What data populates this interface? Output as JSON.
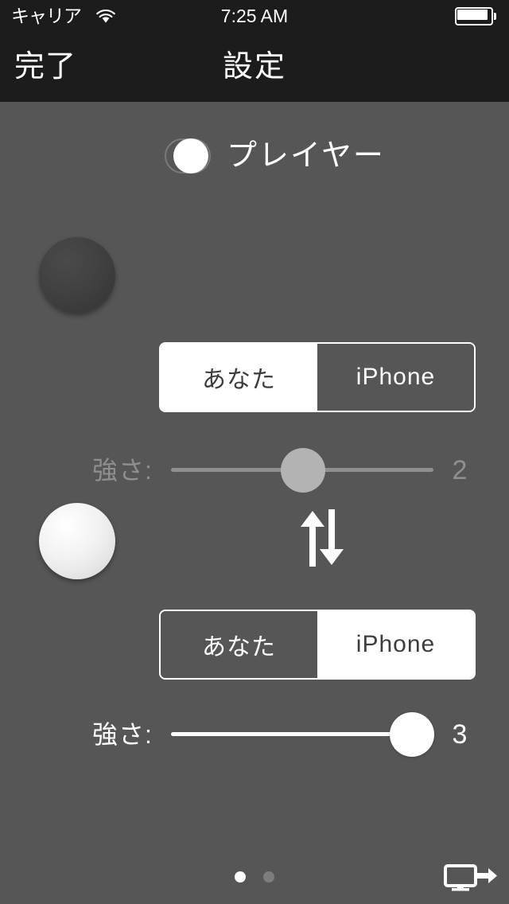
{
  "status_bar": {
    "carrier": "キャリア",
    "wifi_icon": "wifi-icon",
    "time": "7:25 AM",
    "battery_icon": "battery-full-icon"
  },
  "nav_bar": {
    "done_label": "完了",
    "title": "設定"
  },
  "master_toggle": {
    "label": "プレイヤー",
    "state": "on",
    "icon": "toggle-switch"
  },
  "players": [
    {
      "stone": "dark-stone",
      "segmented": {
        "options": [
          {
            "label": "あなた",
            "selected": true
          },
          {
            "label": "iPhone",
            "selected": false
          }
        ]
      },
      "slider": {
        "label": "強さ:",
        "value": "2",
        "enabled": false
      }
    },
    {
      "stone": "light-stone",
      "segmented": {
        "options": [
          {
            "label": "あなた",
            "selected": false
          },
          {
            "label": "iPhone",
            "selected": true
          }
        ]
      },
      "slider": {
        "label": "強さ:",
        "value": "3",
        "enabled": true
      }
    }
  ],
  "swap_icon": "swap-vertical-arrows-icon",
  "page_dots": {
    "count": 2,
    "active_index": 0
  },
  "display_button": {
    "icon": "external-display-arrow-icon"
  },
  "colors": {
    "background": "#565656",
    "bar": "#1c1c1c",
    "accent": "#ffffff",
    "disabled": "#8f8f8f"
  }
}
